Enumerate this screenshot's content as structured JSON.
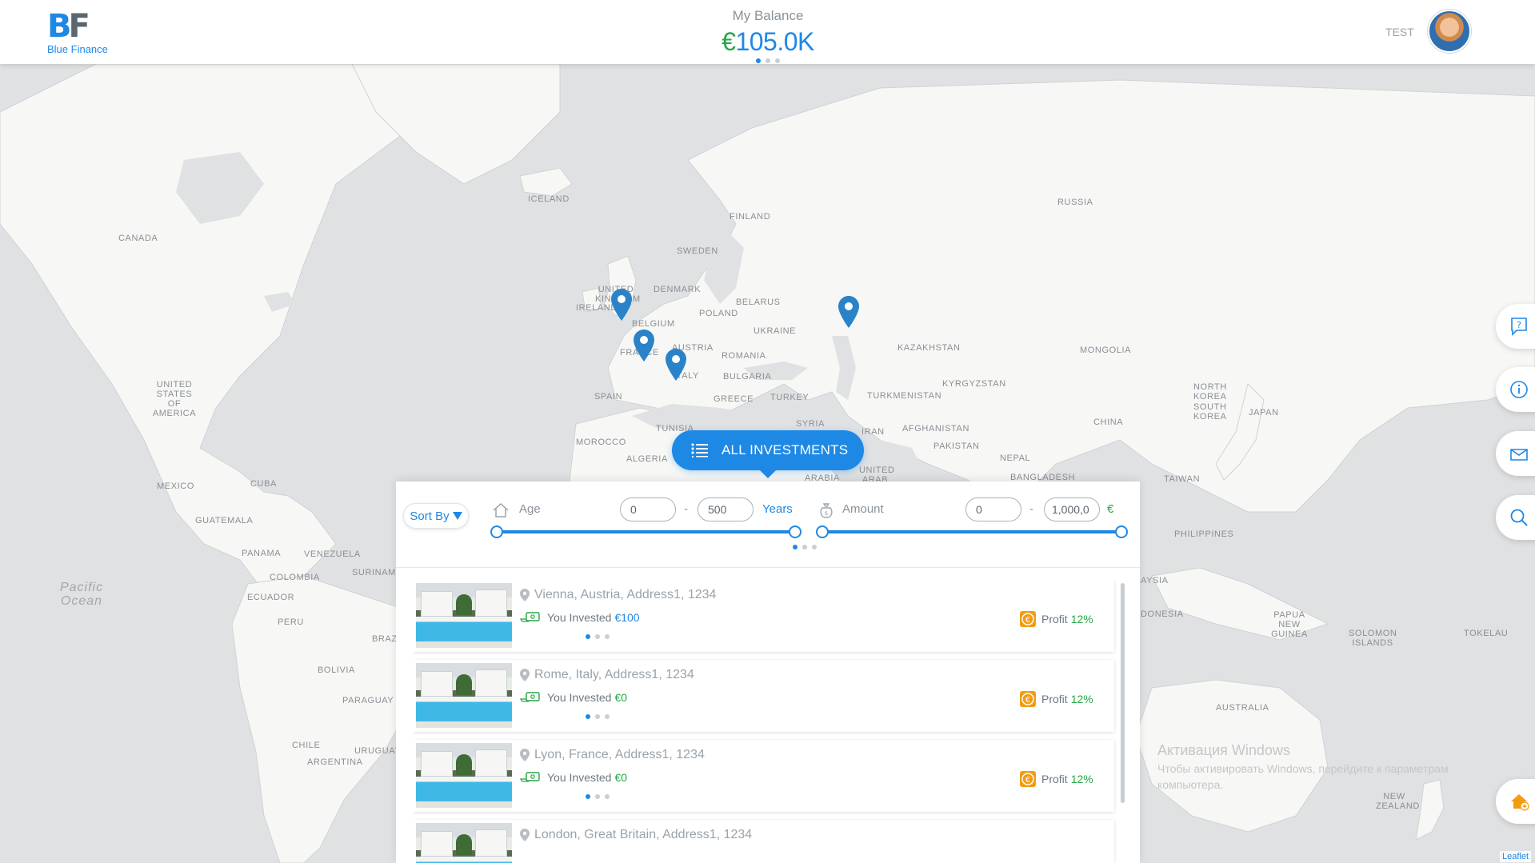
{
  "header": {
    "logo_letters": "BF",
    "logo_text": "Blue Finance",
    "balance_label": "My Balance",
    "balance_currency": "€",
    "balance_value": "105.0K",
    "user_name": "TEST"
  },
  "map": {
    "countries": [
      {
        "name": "ICELAND"
      },
      {
        "name": "CANADA"
      },
      {
        "name": "RUSSIA"
      },
      {
        "name": "FINLAND"
      },
      {
        "name": "SWEDEN"
      },
      {
        "name": "DENMARK"
      },
      {
        "name": "UNITED KINGDOM"
      },
      {
        "name": "IRELAND"
      },
      {
        "name": "BELARUS"
      },
      {
        "name": "POLAND"
      },
      {
        "name": "BELGIUM"
      },
      {
        "name": "UKRAINE"
      },
      {
        "name": "FRANCE"
      },
      {
        "name": "AUSTRIA"
      },
      {
        "name": "ROMANIA"
      },
      {
        "name": "ITALY"
      },
      {
        "name": "BULGARIA"
      },
      {
        "name": "KAZAKHSTAN"
      },
      {
        "name": "MONGOLIA"
      },
      {
        "name": "UNITED STATES OF AMERICA"
      },
      {
        "name": "SPAIN"
      },
      {
        "name": "GREECE"
      },
      {
        "name": "TURKEY"
      },
      {
        "name": "TURKMENISTAN"
      },
      {
        "name": "KYRGYZSTAN"
      },
      {
        "name": "NORTH KOREA"
      },
      {
        "name": "SOUTH KOREA"
      },
      {
        "name": "JAPAN"
      },
      {
        "name": "TUNISIA"
      },
      {
        "name": "SYRIA"
      },
      {
        "name": "IRAN"
      },
      {
        "name": "AFGHANISTAN"
      },
      {
        "name": "CHINA"
      },
      {
        "name": "MOROCCO"
      },
      {
        "name": "PAKISTAN"
      },
      {
        "name": "ALGERIA"
      },
      {
        "name": "NEPAL"
      },
      {
        "name": "ARABIA"
      },
      {
        "name": "UNITED ARAB"
      },
      {
        "name": "BANGLADESH"
      },
      {
        "name": "TAIWAN"
      },
      {
        "name": "MEXICO"
      },
      {
        "name": "CUBA"
      },
      {
        "name": "GUATEMALA"
      },
      {
        "name": "PHILIPPINES"
      },
      {
        "name": "PANAMA"
      },
      {
        "name": "VENEZUELA"
      },
      {
        "name": "SURINAME"
      },
      {
        "name": "COLOMBIA"
      },
      {
        "name": "ECUADOR"
      },
      {
        "name": "PERU"
      },
      {
        "name": "BRAZ"
      },
      {
        "name": "BOLIVIA"
      },
      {
        "name": "PARAGUAY"
      },
      {
        "name": "CHILE"
      },
      {
        "name": "URUGUAY"
      },
      {
        "name": "ARGENTINA"
      },
      {
        "name": "AYSIA"
      },
      {
        "name": "DONESIA"
      },
      {
        "name": "PAPUA NEW GUINEA"
      },
      {
        "name": "SOLOMON ISLANDS"
      },
      {
        "name": "TOKELAU"
      },
      {
        "name": "AUSTRALIA"
      },
      {
        "name": "NEW ZEALAND"
      }
    ],
    "ocean": "Pacific Ocean",
    "marker_count": 4,
    "attribution": "Leaflet"
  },
  "side_buttons": [
    "help-icon",
    "info-icon",
    "mail-icon",
    "search-icon",
    "add-home-icon"
  ],
  "all_investments": {
    "label": "ALL INVESTMENTS"
  },
  "filters": {
    "sort_label": "Sort By",
    "age_label": "Age",
    "age_min": "0",
    "age_max": "500",
    "age_unit": "Years",
    "amount_label": "Amount",
    "amount_min": "0",
    "amount_max": "1,000,0",
    "amount_unit": "€",
    "age_range": [
      0,
      500
    ],
    "amount_range_fraction": [
      0,
      1
    ]
  },
  "investments": [
    {
      "address": "Vienna, Austria, Address1, 1234",
      "invested_label": "You Invested",
      "invested": "€100",
      "profit_label": "Profit",
      "profit": "12%"
    },
    {
      "address": "Rome, Italy, Address1, 1234",
      "invested_label": "You Invested",
      "invested": "€0",
      "profit_label": "Profit",
      "profit": "12%"
    },
    {
      "address": "Lyon, France, Address1, 1234",
      "invested_label": "You Invested",
      "invested": "€0",
      "profit_label": "Profit",
      "profit": "12%"
    },
    {
      "address": "London, Great Britain, Address1, 1234"
    }
  ],
  "watermark": {
    "title": "Активация Windows",
    "line1": "Чтобы активировать Windows, перейдите к параметрам",
    "line2": "компьютера."
  },
  "colors": {
    "accent": "#1e88e5",
    "money": "#27a744",
    "map_water": "#dfe1e2",
    "map_land": "#f7f7f5",
    "profit_icon": "#f39c12"
  }
}
